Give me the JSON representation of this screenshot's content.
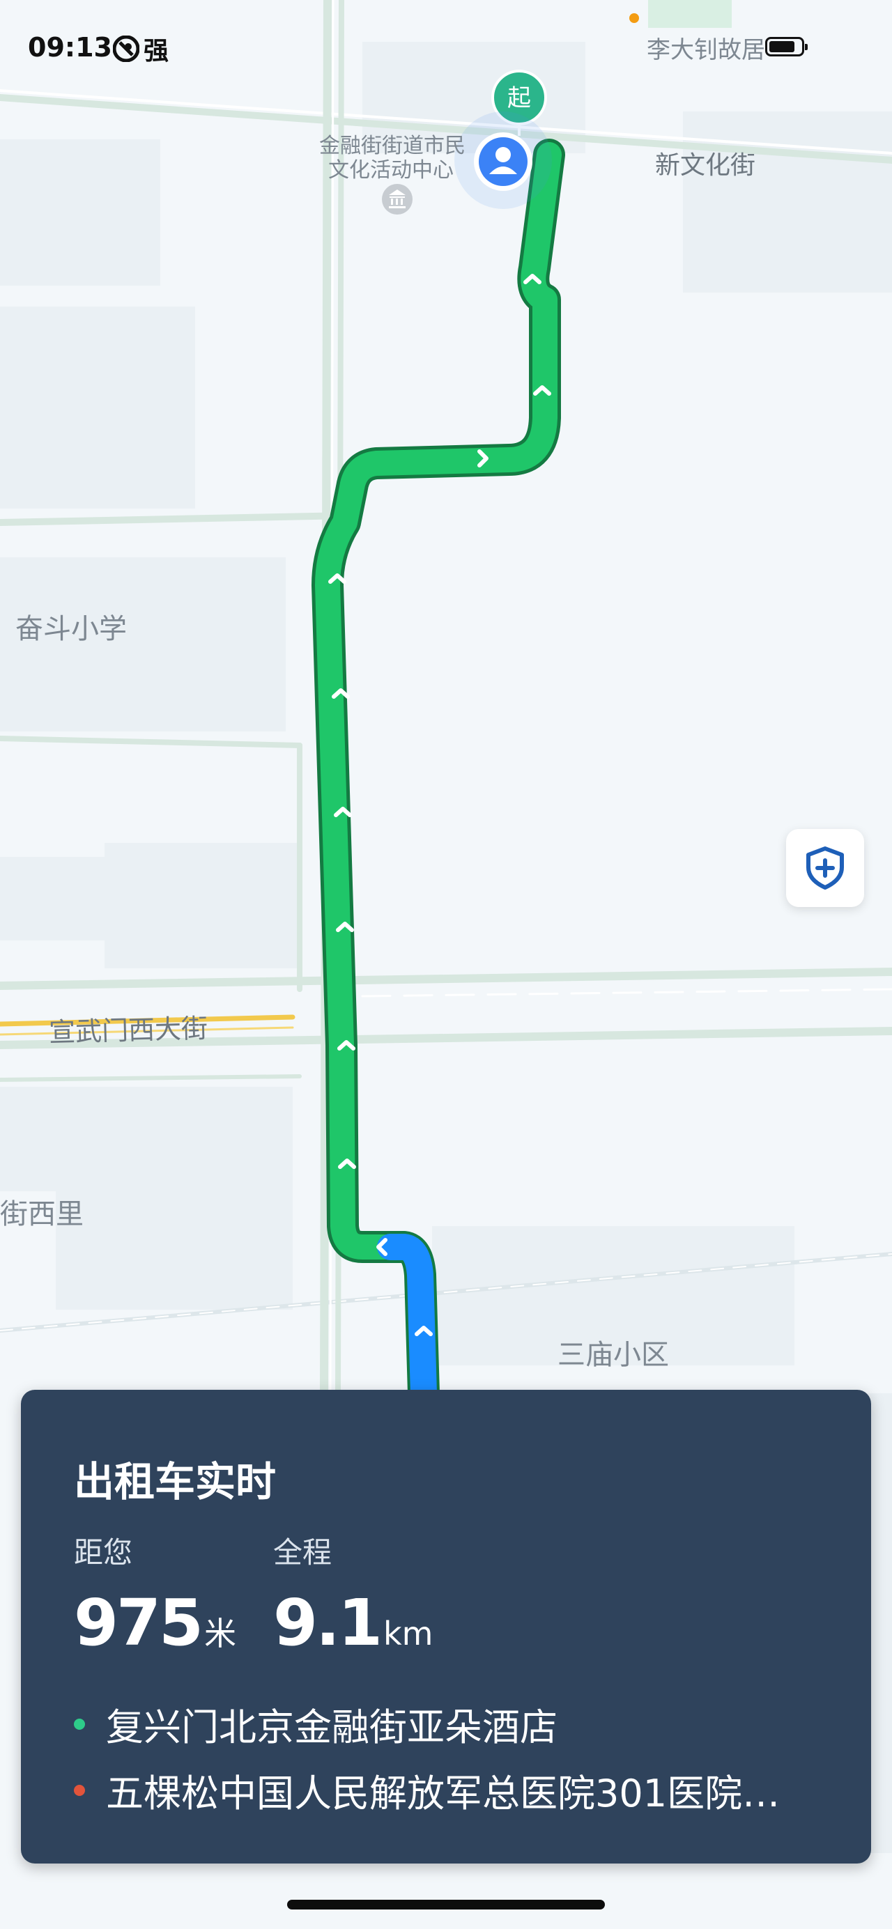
{
  "status_bar": {
    "time": "09:13",
    "signal_label": "强"
  },
  "map": {
    "labels": {
      "poi_top": "李大钊故居",
      "poi_center_line1": "金融街街道市民",
      "poi_center_line2": "文化活动中心",
      "street_new_culture": "新文化街",
      "school": "奋斗小学",
      "street_xuanwumen": "宣武门西大街",
      "area_west": "街西里",
      "community": "三庙小区"
    },
    "start_marker": "起",
    "colors": {
      "route_green": "#1fc669",
      "route_blue": "#1a8cff",
      "map_bg": "#f3f7fa",
      "road": "#dbe8e2",
      "main_road": "#f2c94c"
    }
  },
  "card": {
    "title": "出租车实时",
    "distance_label": "距您",
    "distance_value": "975",
    "distance_unit": "米",
    "total_label": "全程",
    "total_value": "9.1",
    "total_unit": "km",
    "origin": "复兴门北京金融街亚朵酒店",
    "destination": "五棵松中国人民解放军总医院301医院…",
    "origin_color": "#2ecc8a",
    "destination_color": "#e2543b"
  }
}
